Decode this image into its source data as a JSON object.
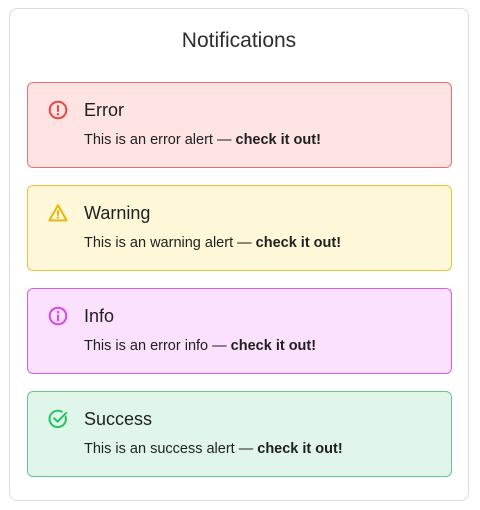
{
  "panel": {
    "title": "Notifications"
  },
  "alerts": [
    {
      "kind": "error",
      "icon": "alert-circle-icon",
      "title": "Error",
      "message": "This is an error alert — ",
      "emphasis": "check it out!",
      "colors": {
        "background": "#fee3e3",
        "border": "#ec6f6f",
        "icon": "#ef4444"
      }
    },
    {
      "kind": "warning",
      "icon": "warning-triangle-icon",
      "title": "Warning",
      "message": "This is an warning alert — ",
      "emphasis": "check it out!",
      "colors": {
        "background": "#fef7d8",
        "border": "#e8c33c",
        "icon": "#eab308"
      }
    },
    {
      "kind": "info",
      "icon": "info-circle-icon",
      "title": "Info",
      "message": "This is an error info — ",
      "emphasis": "check it out!",
      "colors": {
        "background": "#fbe1fd",
        "border": "#d75ee6",
        "icon": "#d946ef"
      }
    },
    {
      "kind": "success",
      "icon": "check-circle-icon",
      "title": "Success",
      "message": "This is an success alert — ",
      "emphasis": "check it out!",
      "colors": {
        "background": "#e1f6eb",
        "border": "#5fcb8d",
        "icon": "#22c55e"
      }
    }
  ]
}
